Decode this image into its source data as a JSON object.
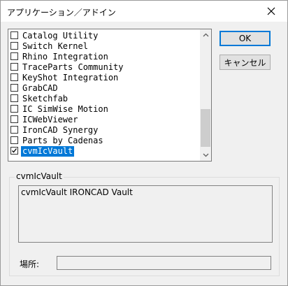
{
  "window": {
    "title": "アプリケーション／アドイン"
  },
  "addins": [
    {
      "label": "Catalog Utility",
      "checked": false,
      "selected": false
    },
    {
      "label": "Switch Kernel",
      "checked": false,
      "selected": false
    },
    {
      "label": "Rhino Integration",
      "checked": false,
      "selected": false
    },
    {
      "label": "TraceParts Community",
      "checked": false,
      "selected": false
    },
    {
      "label": "KeyShot Integration",
      "checked": false,
      "selected": false
    },
    {
      "label": "GrabCAD",
      "checked": false,
      "selected": false
    },
    {
      "label": "Sketchfab",
      "checked": false,
      "selected": false
    },
    {
      "label": "IC SimWise Motion",
      "checked": false,
      "selected": false
    },
    {
      "label": "ICWebViewer",
      "checked": false,
      "selected": false
    },
    {
      "label": "IronCAD Synergy",
      "checked": false,
      "selected": false
    },
    {
      "label": "Parts by Cadenas",
      "checked": false,
      "selected": false
    },
    {
      "label": "cvmIcVault",
      "checked": true,
      "selected": true
    }
  ],
  "buttons": {
    "ok": "OK",
    "cancel": "キャンセル"
  },
  "details": {
    "group_title": "cvmIcVault",
    "description": "cvmIcVault IRONCAD Vault",
    "location_label": "場所:",
    "location_value": ""
  },
  "colors": {
    "selection": "#0078d7",
    "default_button_border": "#0078d7"
  }
}
